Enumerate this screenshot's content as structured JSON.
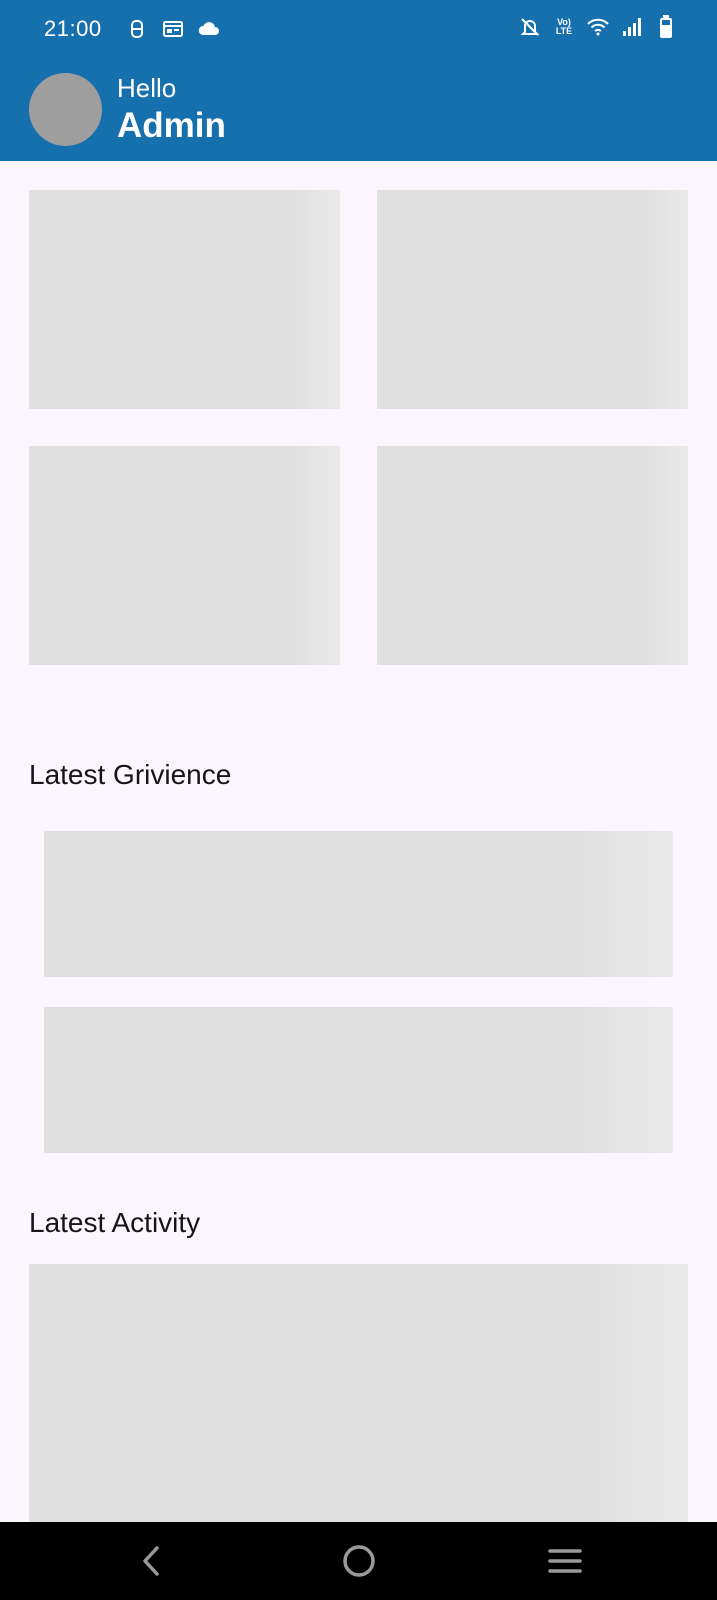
{
  "status_bar": {
    "time": "21:00",
    "left_icons": [
      "notification-icon",
      "calendar-icon",
      "cloud-icon"
    ],
    "right_icons": [
      "bell-off-icon",
      "volte-icon",
      "wifi-icon",
      "signal-icon",
      "battery-icon"
    ],
    "volte_text_top": "Vo)",
    "volte_text_bottom": "LTE"
  },
  "header": {
    "greeting": "Hello",
    "username": "Admin",
    "background_color": "#1670AE"
  },
  "sections": {
    "latest_grievance_title": "Latest Grivience",
    "latest_activity_title": "Latest Activity"
  },
  "nav_bar": {
    "buttons": [
      "back-icon",
      "home-icon",
      "recents-icon"
    ]
  }
}
